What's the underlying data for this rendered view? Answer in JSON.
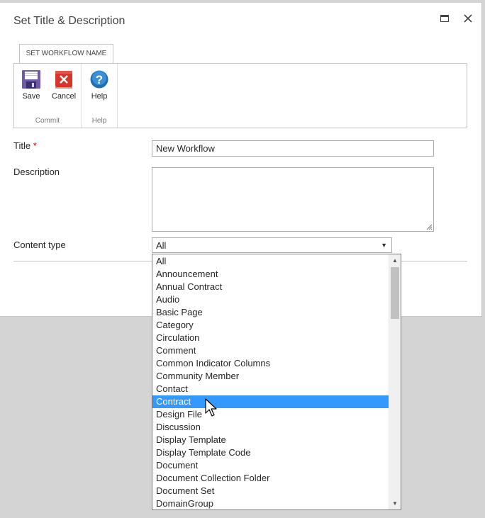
{
  "dialog": {
    "title": "Set Title & Description",
    "maximize_icon": "maximize-icon",
    "close_icon": "close-icon"
  },
  "ribbon": {
    "tab_label": "SET WORKFLOW NAME",
    "groups": [
      {
        "label": "Commit",
        "buttons": [
          {
            "label": "Save",
            "icon": "save-icon"
          },
          {
            "label": "Cancel",
            "icon": "cancel-icon"
          }
        ]
      },
      {
        "label": "Help",
        "buttons": [
          {
            "label": "Help",
            "icon": "help-icon"
          }
        ]
      }
    ]
  },
  "form": {
    "title_label": "Title",
    "required_marker": "*",
    "title_value": "New Workflow",
    "description_label": "Description",
    "description_value": "",
    "content_type_label": "Content type",
    "content_type_value": "All",
    "dropdown_arrow": "▼"
  },
  "dropdown": {
    "selected": "Contract",
    "options": [
      "All",
      "Announcement",
      "Annual Contract",
      "Audio",
      "Basic Page",
      "Category",
      "Circulation",
      "Comment",
      "Common Indicator Columns",
      "Community Member",
      "Contact",
      "Contract",
      "Design File",
      "Discussion",
      "Display Template",
      "Display Template Code",
      "Document",
      "Document Collection Folder",
      "Document Set",
      "DomainGroup"
    ]
  },
  "colors": {
    "selection": "#3399ff",
    "required": "#bf0000",
    "overlay": "#d4d4d4"
  }
}
